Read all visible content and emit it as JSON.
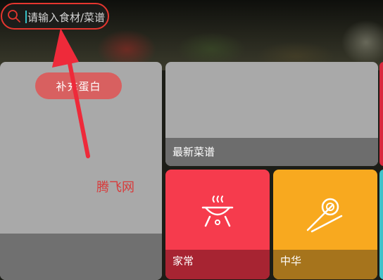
{
  "search": {
    "placeholder": "请输入食材/菜谱",
    "icon": "search-icon"
  },
  "promo_tag": "补充蛋白",
  "watermark": "腾飞网",
  "tiles": {
    "recipes": {
      "label": "最新菜谱"
    },
    "home": {
      "label": "家常",
      "icon": "grill-icon"
    },
    "chinese": {
      "label": "中华",
      "icon": "noodles-icon"
    }
  },
  "colors": {
    "search_border": "#e5362f",
    "cursor": "#38c1c8",
    "home_tile": "#f63b4d",
    "chinese_tile": "#f8a91f",
    "gray_tile": "#a9a9a9",
    "annotation_arrow": "#ee2a3a"
  }
}
